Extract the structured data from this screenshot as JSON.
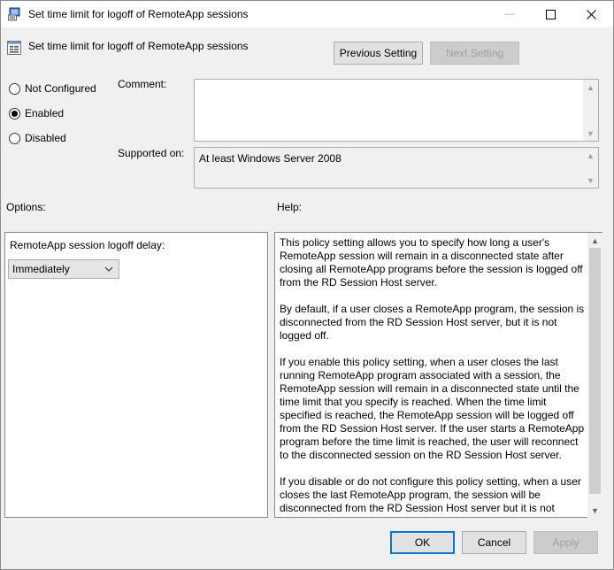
{
  "window": {
    "title": "Set time limit for logoff of RemoteApp sessions",
    "minimize_glyph": "—",
    "maximize_glyph": "☐",
    "close_glyph": "✕"
  },
  "header": {
    "policy_name": "Set time limit for logoff of RemoteApp sessions",
    "previous_label": "Previous Setting",
    "next_label": "Next Setting"
  },
  "state": {
    "options": [
      {
        "label": "Not Configured",
        "checked": false
      },
      {
        "label": "Enabled",
        "checked": true
      },
      {
        "label": "Disabled",
        "checked": false
      }
    ]
  },
  "comment": {
    "label": "Comment:",
    "value": ""
  },
  "supported": {
    "label": "Supported on:",
    "value": "At least Windows Server 2008"
  },
  "options_panel": {
    "label": "Options:",
    "field_label": "RemoteApp session logoff delay:",
    "selected_value": "Immediately"
  },
  "help_panel": {
    "label": "Help:",
    "paragraphs": [
      "This policy setting allows you to specify how long a user's RemoteApp session will remain in a disconnected state after closing all RemoteApp programs before the session is logged off from the RD Session Host server.",
      "By default, if a user closes a RemoteApp program, the session is disconnected from the RD Session Host server, but it is not logged off.",
      "If you enable this policy setting, when a user closes the last running RemoteApp program associated with a session, the RemoteApp session will remain in a disconnected state until the time limit that you specify is reached. When the time limit specified is reached, the RemoteApp session will be logged off from the RD Session Host server. If the user starts a RemoteApp program before the time limit is reached, the user will reconnect to the disconnected session on the RD Session Host server.",
      "If you disable or do not configure this policy setting, when a user closes the last RemoteApp program, the session will be disconnected from the RD Session Host server but it is not logged off."
    ]
  },
  "footer": {
    "ok_label": "OK",
    "cancel_label": "Cancel",
    "apply_label": "Apply"
  },
  "colors": {
    "accent": "#0078d7",
    "dialog_bg": "#f0f0f0",
    "disabled_text": "#a0a0a0"
  }
}
